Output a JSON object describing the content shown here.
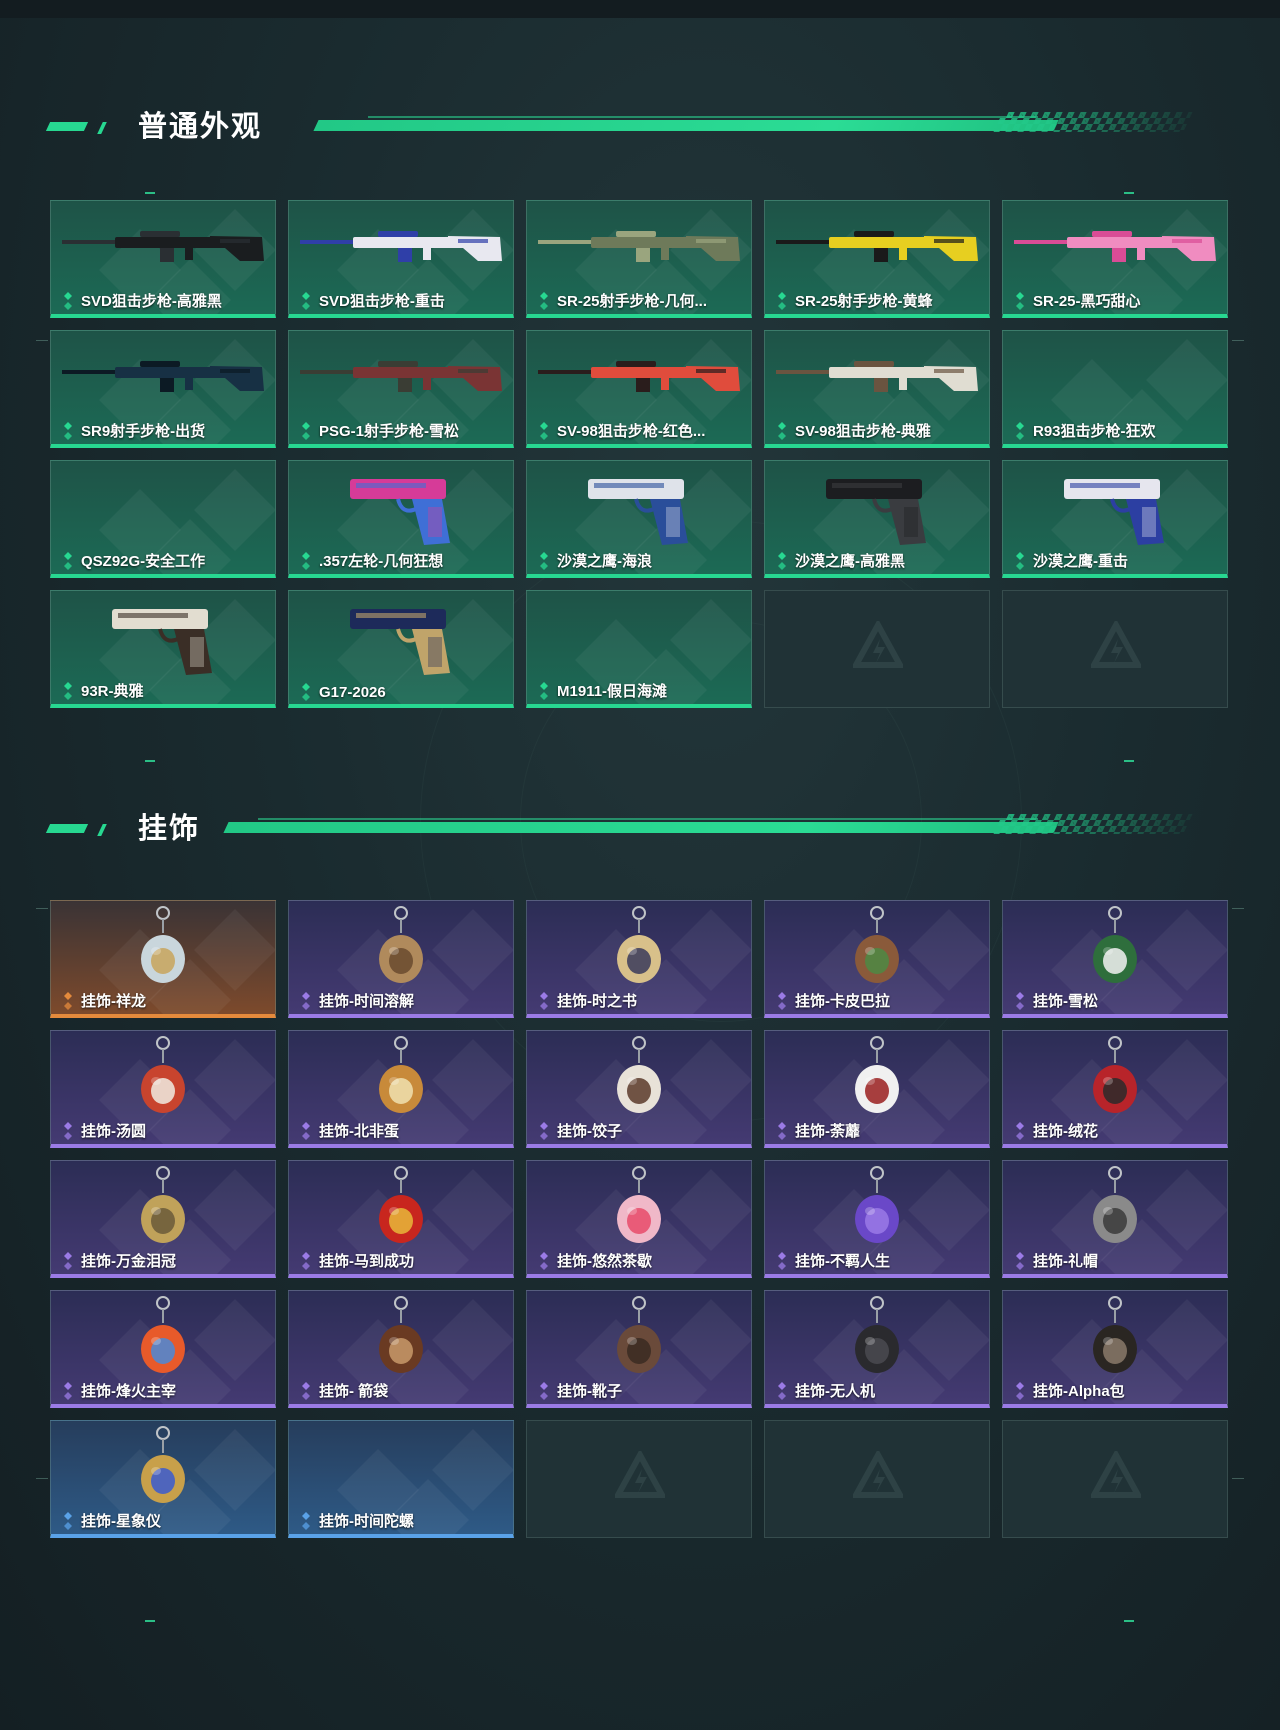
{
  "sections": [
    {
      "title": "普通外观",
      "theme_color": "#27d891",
      "items": [
        {
          "label": "SVD狙击步枪-高雅黑",
          "rarity": "green",
          "thumb": "rifle",
          "colors": [
            "#1a1d1f",
            "#2a2f33"
          ]
        },
        {
          "label": "SVD狙击步枪-重击",
          "rarity": "green",
          "thumb": "rifle",
          "colors": [
            "#e8e8f0",
            "#2f3fa8"
          ]
        },
        {
          "label": "SR-25射手步枪-几何...",
          "rarity": "green",
          "thumb": "rifle",
          "colors": [
            "#6e7a5a",
            "#9aa57e"
          ]
        },
        {
          "label": "SR-25射手步枪-黄蜂",
          "rarity": "green",
          "thumb": "rifle",
          "colors": [
            "#e7cf20",
            "#1a1a1a"
          ]
        },
        {
          "label": "SR-25-黑巧甜心",
          "rarity": "green",
          "thumb": "rifle",
          "colors": [
            "#f08cc0",
            "#d94c96"
          ]
        },
        {
          "label": "SR9射手步枪-出货",
          "rarity": "green",
          "thumb": "rifle",
          "colors": [
            "#173044",
            "#0c1a24"
          ]
        },
        {
          "label": "PSG-1射手步枪-雪松",
          "rarity": "green",
          "thumb": "rifle",
          "colors": [
            "#7a3434",
            "#3a3d34"
          ]
        },
        {
          "label": "SV-98狙击步枪-红色...",
          "rarity": "green",
          "thumb": "rifle",
          "colors": [
            "#e04c3c",
            "#2a1d1c"
          ]
        },
        {
          "label": "SV-98狙击步枪-典雅",
          "rarity": "green",
          "thumb": "rifle",
          "colors": [
            "#e0ddd2",
            "#6a5440"
          ]
        },
        {
          "label": "R93狙击步枪-狂欢",
          "rarity": "green",
          "thumb": "none",
          "colors": []
        },
        {
          "label": "QSZ92G-安全工作",
          "rarity": "green",
          "thumb": "none",
          "colors": []
        },
        {
          "label": ".357左轮-几何狂想",
          "rarity": "green",
          "thumb": "pistol",
          "colors": [
            "#d63b98",
            "#3f6fd6"
          ]
        },
        {
          "label": "沙漠之鹰-海浪",
          "rarity": "green",
          "thumb": "pistol",
          "colors": [
            "#dfe3ea",
            "#2a4e9a"
          ]
        },
        {
          "label": "沙漠之鹰-高雅黑",
          "rarity": "green",
          "thumb": "pistol",
          "colors": [
            "#1c1d20",
            "#3a3c40"
          ]
        },
        {
          "label": "沙漠之鹰-重击",
          "rarity": "green",
          "thumb": "pistol",
          "colors": [
            "#e6e6ee",
            "#2c3fa2"
          ]
        },
        {
          "label": "93R-典雅",
          "rarity": "green",
          "thumb": "pistol",
          "colors": [
            "#e2ddd0",
            "#3a2e26"
          ]
        },
        {
          "label": "G17-2026",
          "rarity": "green",
          "thumb": "pistol",
          "colors": [
            "#1d2a5a",
            "#c0a46a"
          ]
        },
        {
          "label": "M1911-假日海滩",
          "rarity": "green",
          "thumb": "none",
          "colors": []
        },
        {
          "label": "",
          "rarity": "empty"
        },
        {
          "label": "",
          "rarity": "empty"
        }
      ]
    },
    {
      "title": "挂饰",
      "theme_color": "#27d891",
      "items": [
        {
          "label": "挂饰-祥龙",
          "rarity": "orange",
          "thumb": "charm",
          "colors": [
            "#c9d6dc",
            "#c8a45c"
          ]
        },
        {
          "label": "挂饰-时间溶解",
          "rarity": "purple",
          "thumb": "charm",
          "colors": [
            "#b08a5c",
            "#6a4a2e"
          ]
        },
        {
          "label": "挂饰-时之书",
          "rarity": "purple",
          "thumb": "charm",
          "colors": [
            "#d8c08a",
            "#3a3a5a"
          ]
        },
        {
          "label": "挂饰-卡皮巴拉",
          "rarity": "purple",
          "thumb": "charm",
          "colors": [
            "#8a5a3a",
            "#4c8a44"
          ]
        },
        {
          "label": "挂饰-雪松",
          "rarity": "purple",
          "thumb": "charm",
          "colors": [
            "#2e6e3c",
            "#f2f2f2"
          ]
        },
        {
          "label": "挂饰-汤圆",
          "rarity": "purple",
          "thumb": "charm",
          "colors": [
            "#c8442e",
            "#f0ece2"
          ]
        },
        {
          "label": "挂饰-北非蛋",
          "rarity": "purple",
          "thumb": "charm",
          "colors": [
            "#c88a3a",
            "#f0e0b0"
          ]
        },
        {
          "label": "挂饰-饺子",
          "rarity": "purple",
          "thumb": "charm",
          "colors": [
            "#e8e2d8",
            "#5a3a2a"
          ]
        },
        {
          "label": "挂饰-荼蘼",
          "rarity": "purple",
          "thumb": "charm",
          "colors": [
            "#f0f0f0",
            "#9a1e1e"
          ]
        },
        {
          "label": "挂饰-绒花",
          "rarity": "purple",
          "thumb": "charm",
          "colors": [
            "#b8242a",
            "#2a2a2a"
          ]
        },
        {
          "label": "挂饰-万金泪冠",
          "rarity": "purple",
          "thumb": "charm",
          "colors": [
            "#c0a25a",
            "#6a5a3a"
          ]
        },
        {
          "label": "挂饰-马到成功",
          "rarity": "purple",
          "thumb": "charm",
          "colors": [
            "#c8261e",
            "#e8b83a"
          ]
        },
        {
          "label": "挂饰-悠然茶歇",
          "rarity": "purple",
          "thumb": "charm",
          "colors": [
            "#f0b8c8",
            "#e84a6a"
          ]
        },
        {
          "label": "挂饰-不羁人生",
          "rarity": "purple",
          "thumb": "charm",
          "colors": [
            "#6a48c8",
            "#9a7ae6"
          ]
        },
        {
          "label": "挂饰-礼帽",
          "rarity": "purple",
          "thumb": "charm",
          "colors": [
            "#8a8a8a",
            "#3a3a3a"
          ]
        },
        {
          "label": "挂饰-烽火主宰",
          "rarity": "purple",
          "thumb": "charm",
          "colors": [
            "#e85a2a",
            "#4a8ad8"
          ]
        },
        {
          "label": "挂饰- 箭袋",
          "rarity": "purple",
          "thumb": "charm",
          "colors": [
            "#6a3a22",
            "#c89a6a"
          ]
        },
        {
          "label": "挂饰-靴子",
          "rarity": "purple",
          "thumb": "charm",
          "colors": [
            "#6a4a3a",
            "#3a2a22"
          ]
        },
        {
          "label": "挂饰-无人机",
          "rarity": "purple",
          "thumb": "charm",
          "colors": [
            "#2a2a2e",
            "#4a4a50"
          ]
        },
        {
          "label": "挂饰-Alpha包",
          "rarity": "purple",
          "thumb": "charm",
          "colors": [
            "#2a2622",
            "#8a7a6a"
          ]
        },
        {
          "label": "挂饰-星象仪",
          "rarity": "blue",
          "thumb": "charm",
          "colors": [
            "#c8a04a",
            "#3a5ad0"
          ]
        },
        {
          "label": "挂饰-时间陀螺",
          "rarity": "blue",
          "thumb": "none",
          "colors": []
        },
        {
          "label": "",
          "rarity": "empty"
        },
        {
          "label": "",
          "rarity": "empty"
        },
        {
          "label": "",
          "rarity": "empty"
        }
      ]
    }
  ],
  "rarity_colors": {
    "green": "#27d891",
    "purple": "#9b7be6",
    "orange": "#e48a3c",
    "blue": "#5aa2e8"
  },
  "icons": {
    "rarity": "rarity-diamond-icon",
    "empty": "triangle-emblem-icon"
  }
}
